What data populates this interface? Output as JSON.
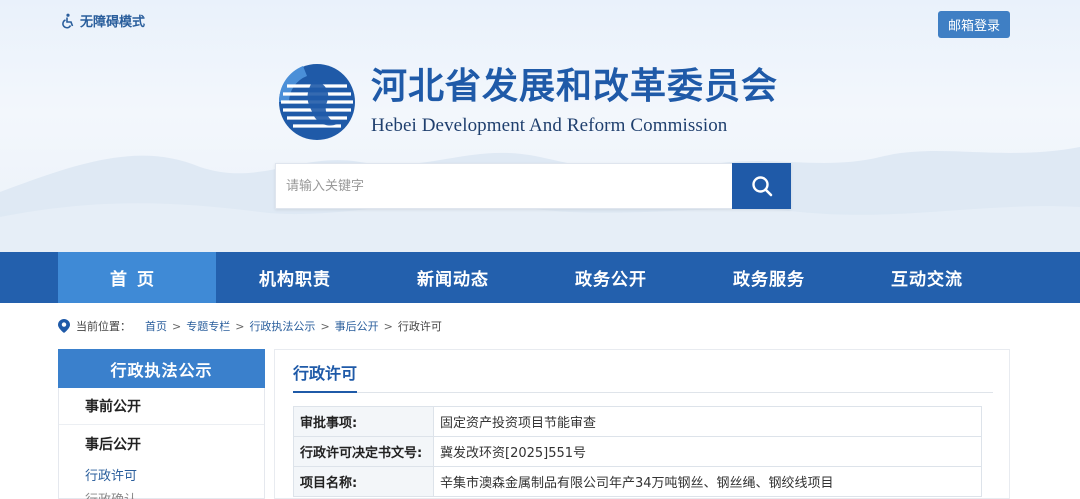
{
  "header": {
    "accessibility_label": "无障碍模式",
    "mail_login_label": "邮箱登录",
    "title_cn": "河北省发展和改革委员会",
    "title_en": "Hebei Development And Reform Commission"
  },
  "search": {
    "placeholder": "请输入关键字"
  },
  "nav": {
    "items": [
      {
        "label": "首页"
      },
      {
        "label": "机构职责"
      },
      {
        "label": "新闻动态"
      },
      {
        "label": "政务公开"
      },
      {
        "label": "政务服务"
      },
      {
        "label": "互动交流"
      }
    ],
    "active_index": 0
  },
  "breadcrumb": {
    "label": "当前位置：",
    "items": [
      "首页",
      "专题专栏",
      "行政执法公示",
      "事后公开",
      "行政许可"
    ],
    "separator": ">"
  },
  "sidebar": {
    "heading": "行政执法公示",
    "items": [
      {
        "label": "事前公开"
      },
      {
        "label": "事后公开"
      }
    ],
    "subitems": [
      "行政许可",
      "行政确认"
    ]
  },
  "main": {
    "title": "行政许可",
    "rows": [
      {
        "key": "审批事项:",
        "value": "固定资产投资项目节能审查"
      },
      {
        "key": "行政许可决定书文号:",
        "value": "冀发改环资[2025]551号"
      },
      {
        "key": "项目名称:",
        "value": "辛集市澳森金属制品有限公司年产34万吨钢丝、钢丝绳、钢绞线项目"
      }
    ]
  },
  "colors": {
    "nav_bg": "#2360ad",
    "nav_active": "#3f8ad6",
    "brand_blue": "#1f5aa8",
    "sidebar_head": "#3a80cc"
  },
  "icons": {
    "accessibility": "wheelchair-icon",
    "search": "search-icon",
    "breadcrumb": "location-pin-icon"
  }
}
